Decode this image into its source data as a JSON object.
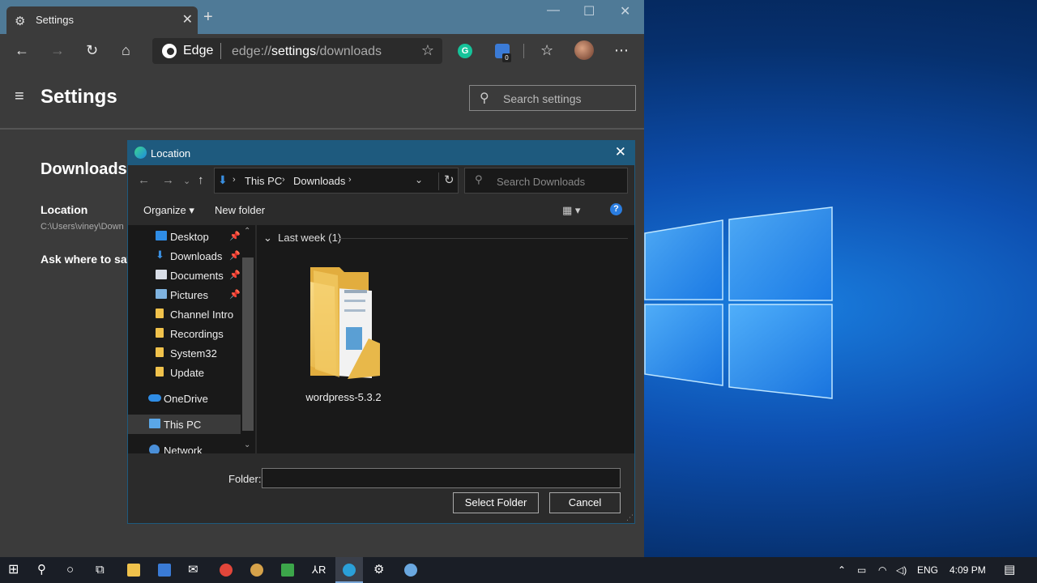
{
  "browser": {
    "tab": {
      "title": "Settings",
      "icon": "gear-icon"
    },
    "window_controls": {
      "minimize": "—",
      "maximize": "☐",
      "close": "✕"
    },
    "address": {
      "brand": "Edge",
      "url_prefix": "edge://",
      "url_main": "settings",
      "url_suffix": "/downloads"
    },
    "extension_badge": "0"
  },
  "settings": {
    "title": "Settings",
    "search_placeholder": "Search settings",
    "section_title": "Downloads",
    "location_label": "Location",
    "location_path": "C:\\Users\\viney\\Down",
    "ask_label": "Ask where to sav"
  },
  "dialog": {
    "title": "Location",
    "breadcrumb": [
      "This PC",
      "Downloads"
    ],
    "search_placeholder": "Search Downloads",
    "organize": "Organize",
    "new_folder": "New folder",
    "help": "?",
    "nav_items": [
      {
        "label": "Desktop",
        "icon": "desktop-icon",
        "pinned": true
      },
      {
        "label": "Downloads",
        "icon": "download-icon",
        "pinned": true
      },
      {
        "label": "Documents",
        "icon": "documents-icon",
        "pinned": true
      },
      {
        "label": "Pictures",
        "icon": "pictures-icon",
        "pinned": true
      },
      {
        "label": "Channel Intro",
        "icon": "folder-icon",
        "pinned": false
      },
      {
        "label": "Recordings",
        "icon": "folder-icon",
        "pinned": false
      },
      {
        "label": "System32",
        "icon": "folder-icon",
        "pinned": false
      },
      {
        "label": "Update",
        "icon": "folder-icon",
        "pinned": false
      },
      {
        "label": "OneDrive",
        "icon": "onedrive-icon",
        "pinned": false
      },
      {
        "label": "This PC",
        "icon": "this-pc-icon",
        "pinned": false,
        "selected": true
      },
      {
        "label": "Network",
        "icon": "network-icon",
        "pinned": false
      }
    ],
    "group_header": "Last week (1)",
    "items": [
      {
        "label": "wordpress-5.3.2",
        "icon": "folder-icon"
      }
    ],
    "folder_field_label": "Folder:",
    "folder_value": "",
    "select_button": "Select Folder",
    "cancel_button": "Cancel"
  },
  "taskbar": {
    "language": "ENG",
    "time": "4:09 PM"
  }
}
